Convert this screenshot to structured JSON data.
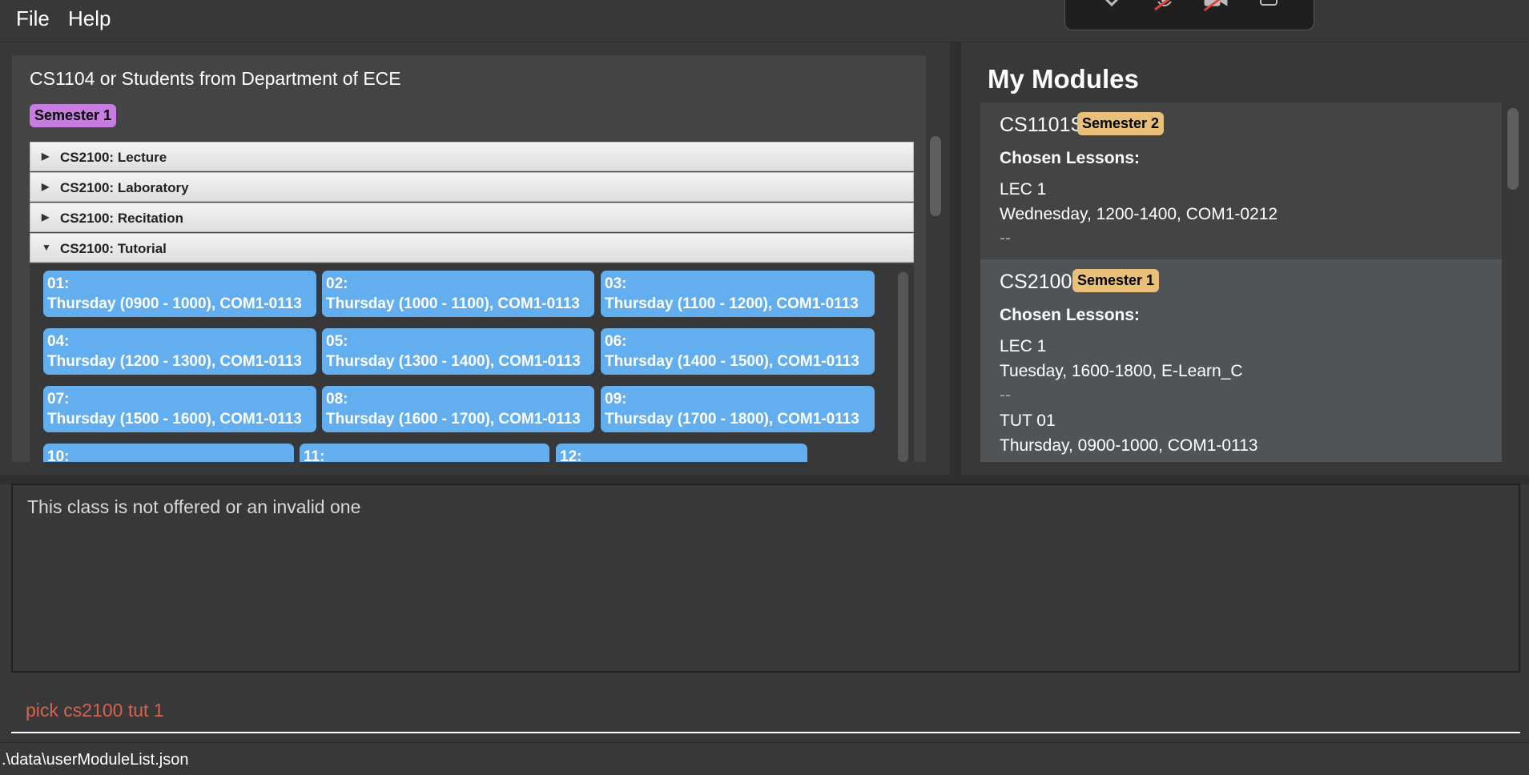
{
  "menu": {
    "file": "File",
    "help": "Help"
  },
  "left": {
    "title": "CS1104 or Students from Department of ECE",
    "semester_badge": "Semester 1",
    "accordions": [
      {
        "label": "CS2100: Lecture",
        "expanded": false
      },
      {
        "label": "CS2100: Laboratory",
        "expanded": false
      },
      {
        "label": "CS2100: Recitation",
        "expanded": false
      },
      {
        "label": "CS2100: Tutorial",
        "expanded": true
      }
    ],
    "tutorial_slots": [
      {
        "num": "01:",
        "time": "Thursday (0900 - 1000), COM1-0113"
      },
      {
        "num": "02:",
        "time": "Thursday (1000 - 1100), COM1-0113"
      },
      {
        "num": "03:",
        "time": "Thursday (1100 - 1200), COM1-0113"
      },
      {
        "num": "04:",
        "time": "Thursday (1200 - 1300), COM1-0113"
      },
      {
        "num": "05:",
        "time": "Thursday (1300 - 1400), COM1-0113"
      },
      {
        "num": "06:",
        "time": "Thursday (1400 - 1500), COM1-0113"
      },
      {
        "num": "07:",
        "time": "Thursday (1500 - 1600), COM1-0113"
      },
      {
        "num": "08:",
        "time": "Thursday (1600 - 1700), COM1-0113"
      },
      {
        "num": "09:",
        "time": "Thursday (1700 - 1800), COM1-0113"
      },
      {
        "num": "10:",
        "time": ""
      },
      {
        "num": "11:",
        "time": ""
      },
      {
        "num": "12:",
        "time": ""
      }
    ]
  },
  "right": {
    "title": "My Modules",
    "modules": [
      {
        "code": "CS1101S",
        "semester": "Semester 2",
        "chosen_label": "Chosen Lessons:",
        "lines": [
          "LEC 1",
          "Wednesday, 1200-1400, COM1-0212",
          "--"
        ]
      },
      {
        "code": "CS2100",
        "semester": "Semester 1",
        "chosen_label": "Chosen Lessons:",
        "lines": [
          "LEC 1",
          "Tuesday, 1600-1800, E-Learn_C",
          "--",
          "TUT 01",
          "Thursday, 0900-1000, COM1-0113"
        ]
      }
    ]
  },
  "result": {
    "text": "This class is not offered or an invalid one"
  },
  "command": {
    "value": "pick cs2100 tut 1"
  },
  "status": {
    "path": ".\\data\\userModuleList.json"
  },
  "colors": {
    "semester1_purple": "#c77de0",
    "semester_gold": "#e8c07a",
    "slot_blue": "#62aeef",
    "error_red": "#d9624f"
  }
}
